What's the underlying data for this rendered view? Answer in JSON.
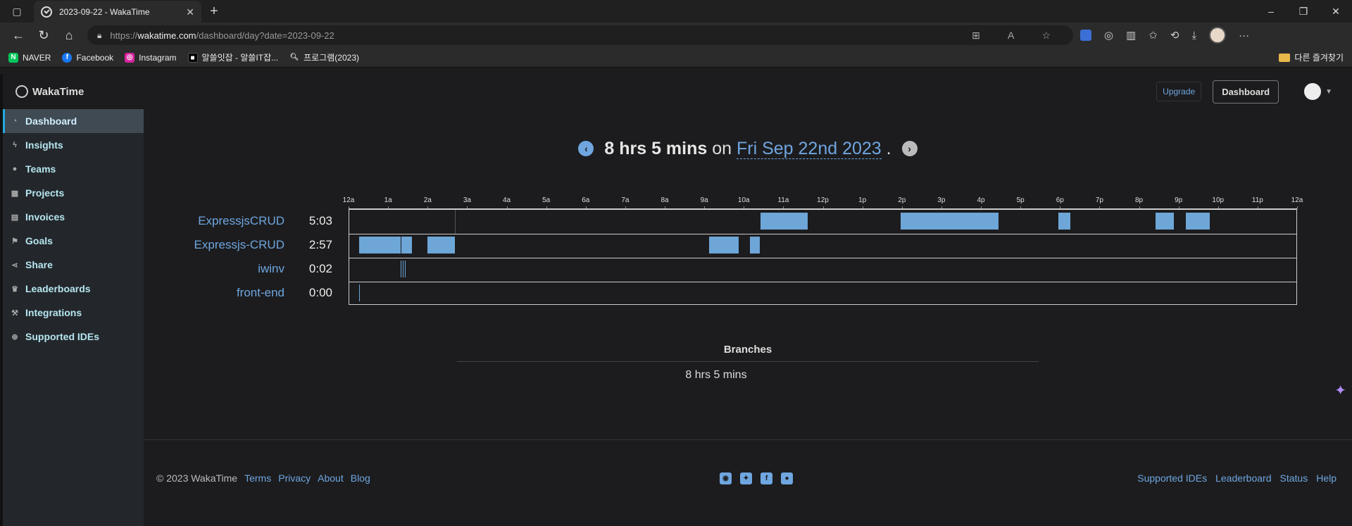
{
  "browser": {
    "tab_title": "2023-09-22 - WakaTime",
    "url_prefix": "https://",
    "url_host": "wakatime.com",
    "url_path": "/dashboard/day?date=2023-09-22",
    "bookmarks": [
      {
        "label": "NAVER",
        "icon": "naver-icon",
        "color": "#03c75a"
      },
      {
        "label": "Facebook",
        "icon": "facebook-icon",
        "color": "#1877f2"
      },
      {
        "label": "Instagram",
        "icon": "instagram-icon",
        "color": "#d6249f"
      },
      {
        "label": "알쓸잇잡 - 알쓸IT잡...",
        "icon": "site-icon",
        "color": "#111111"
      },
      {
        "label": "프로그램(2023)",
        "icon": "search-icon",
        "color": "#2b2b2b"
      }
    ],
    "other_bookmarks": "다른 즐겨찾기"
  },
  "header": {
    "logo": "WakaTime",
    "upgrade": "Upgrade",
    "dashboard": "Dashboard"
  },
  "sidebar": {
    "items": [
      {
        "label": "Dashboard",
        "icon": "dashboard-icon",
        "active": true
      },
      {
        "label": "Insights",
        "icon": "bolt-icon"
      },
      {
        "label": "Teams",
        "icon": "users-icon"
      },
      {
        "label": "Projects",
        "icon": "grid-icon"
      },
      {
        "label": "Invoices",
        "icon": "file-icon"
      },
      {
        "label": "Goals",
        "icon": "flag-icon"
      },
      {
        "label": "Share",
        "icon": "share-icon"
      },
      {
        "label": "Leaderboards",
        "icon": "trophy-icon"
      },
      {
        "label": "Integrations",
        "icon": "wrench-icon"
      },
      {
        "label": "Supported IDEs",
        "icon": "plus-circle-icon"
      }
    ]
  },
  "day": {
    "total": "8 hrs 5 mins",
    "on": "on",
    "date": "Fri Sep 22nd 2023",
    "dot": "."
  },
  "timeline": {
    "hours": [
      "12a",
      "1a",
      "2a",
      "3a",
      "4a",
      "5a",
      "6a",
      "7a",
      "8a",
      "9a",
      "10a",
      "11a",
      "12p",
      "1p",
      "2p",
      "3p",
      "4p",
      "5p",
      "6p",
      "7p",
      "8p",
      "9p",
      "10p",
      "11p",
      "12a"
    ],
    "projects": [
      {
        "name": "ExpressjsCRUD",
        "time": "5:03",
        "segments": [
          [
            10.4,
            11.6
          ],
          [
            13.95,
            16.42
          ],
          [
            17.95,
            18.25
          ],
          [
            20.4,
            20.87
          ],
          [
            21.17,
            21.78
          ]
        ]
      },
      {
        "name": "Expressjs-CRUD",
        "time": "2:57",
        "segments": [
          [
            0.25,
            1.3
          ],
          [
            1.32,
            1.58
          ],
          [
            1.98,
            2.67
          ],
          [
            9.1,
            9.85
          ],
          [
            10.13,
            10.38
          ]
        ]
      },
      {
        "name": "iwinv",
        "time": "0:02",
        "ticks": [
          1.3,
          1.36,
          1.4
        ]
      },
      {
        "name": "front-end",
        "time": "0:00",
        "ticks": [
          0.25
        ]
      }
    ],
    "divider_hour": 2.67
  },
  "branches": {
    "title": "Branches",
    "total": "8 hrs 5 mins"
  },
  "footer": {
    "copyright": "© 2023 WakaTime",
    "left_links": [
      "Terms",
      "Privacy",
      "About",
      "Blog"
    ],
    "right_links": [
      "Supported IDEs",
      "Leaderboard",
      "Status",
      "Help"
    ],
    "social": [
      "github-icon",
      "twitter-icon",
      "facebook-icon",
      "reddit-icon"
    ]
  }
}
